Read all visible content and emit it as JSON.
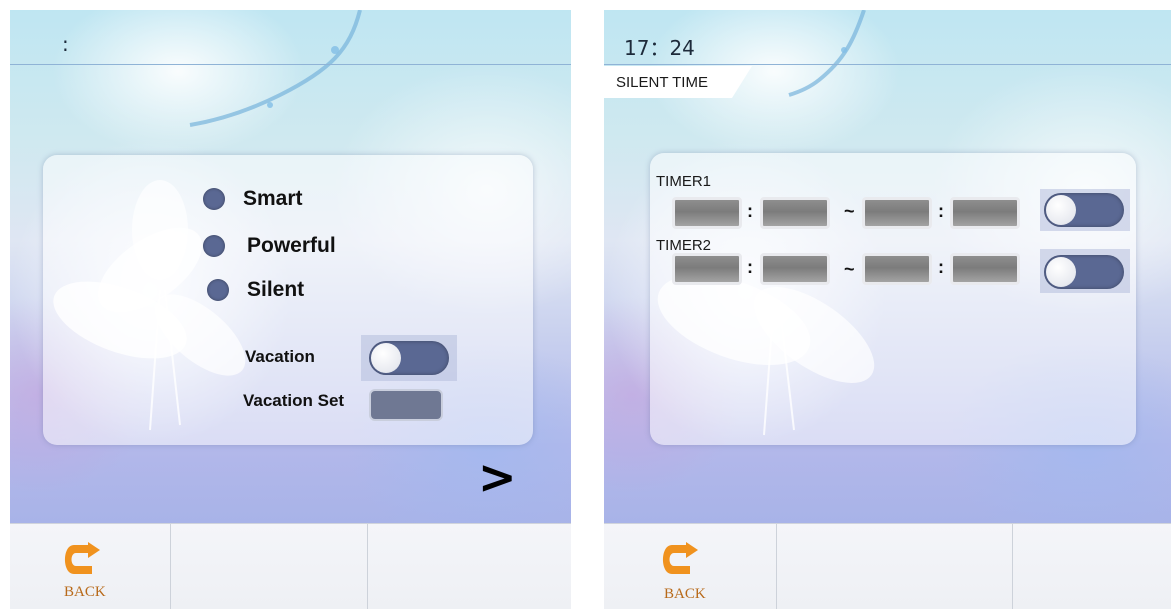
{
  "left_screen": {
    "clock": ":",
    "modes": [
      "Smart",
      "Powerful",
      "Silent"
    ],
    "vacation_label": "Vacation",
    "vacation_set_label": "Vacation Set",
    "next_label": ">",
    "back_label": "BACK"
  },
  "right_screen": {
    "clock": "17：24",
    "title": "SILENT TIME",
    "timers": [
      {
        "label": "TIMER1",
        "colon": ":",
        "tilde": "~"
      },
      {
        "label": "TIMER2",
        "colon": ":",
        "tilde": "~"
      }
    ],
    "back_label": "BACK"
  },
  "colors": {
    "toggle_off": "#5a6893",
    "back_icon": "#f0921e",
    "header_line": "#8fb3d6"
  },
  "icons": {
    "back": "back-arrow-icon",
    "radio": "radio-dot-icon"
  }
}
